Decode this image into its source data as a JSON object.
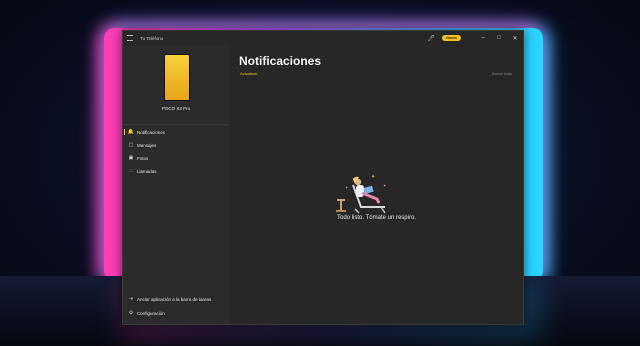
{
  "window": {
    "app_title": "Tu Teléfono",
    "badge_label": "Nuevo",
    "pin_icon": "pin-icon",
    "minimize_icon": "minimize-icon",
    "maximize_icon": "maximize-icon",
    "close_icon": "close-icon"
  },
  "sidebar": {
    "device_name": "POCO X3 Pro",
    "device_color": "#f2c31a",
    "items": [
      {
        "label": "Notificaciones",
        "icon": "bell-icon",
        "active": true
      },
      {
        "label": "Mensajes",
        "icon": "message-icon",
        "active": false
      },
      {
        "label": "Fotos",
        "icon": "photo-icon",
        "active": false
      },
      {
        "label": "Llamadas",
        "icon": "dialpad-icon",
        "active": false
      }
    ],
    "bottom_items": [
      {
        "label": "Anclar aplicación a la barra de tareas",
        "icon": "pin-icon"
      },
      {
        "label": "Configuración",
        "icon": "gear-icon"
      }
    ]
  },
  "main": {
    "title": "Notificaciones",
    "refresh_label": "Actualizar",
    "clear_all_label": "Borrar todo",
    "empty_message": "Todo listo. Tómate un respiro.",
    "accent_color": "#f2c31a"
  }
}
